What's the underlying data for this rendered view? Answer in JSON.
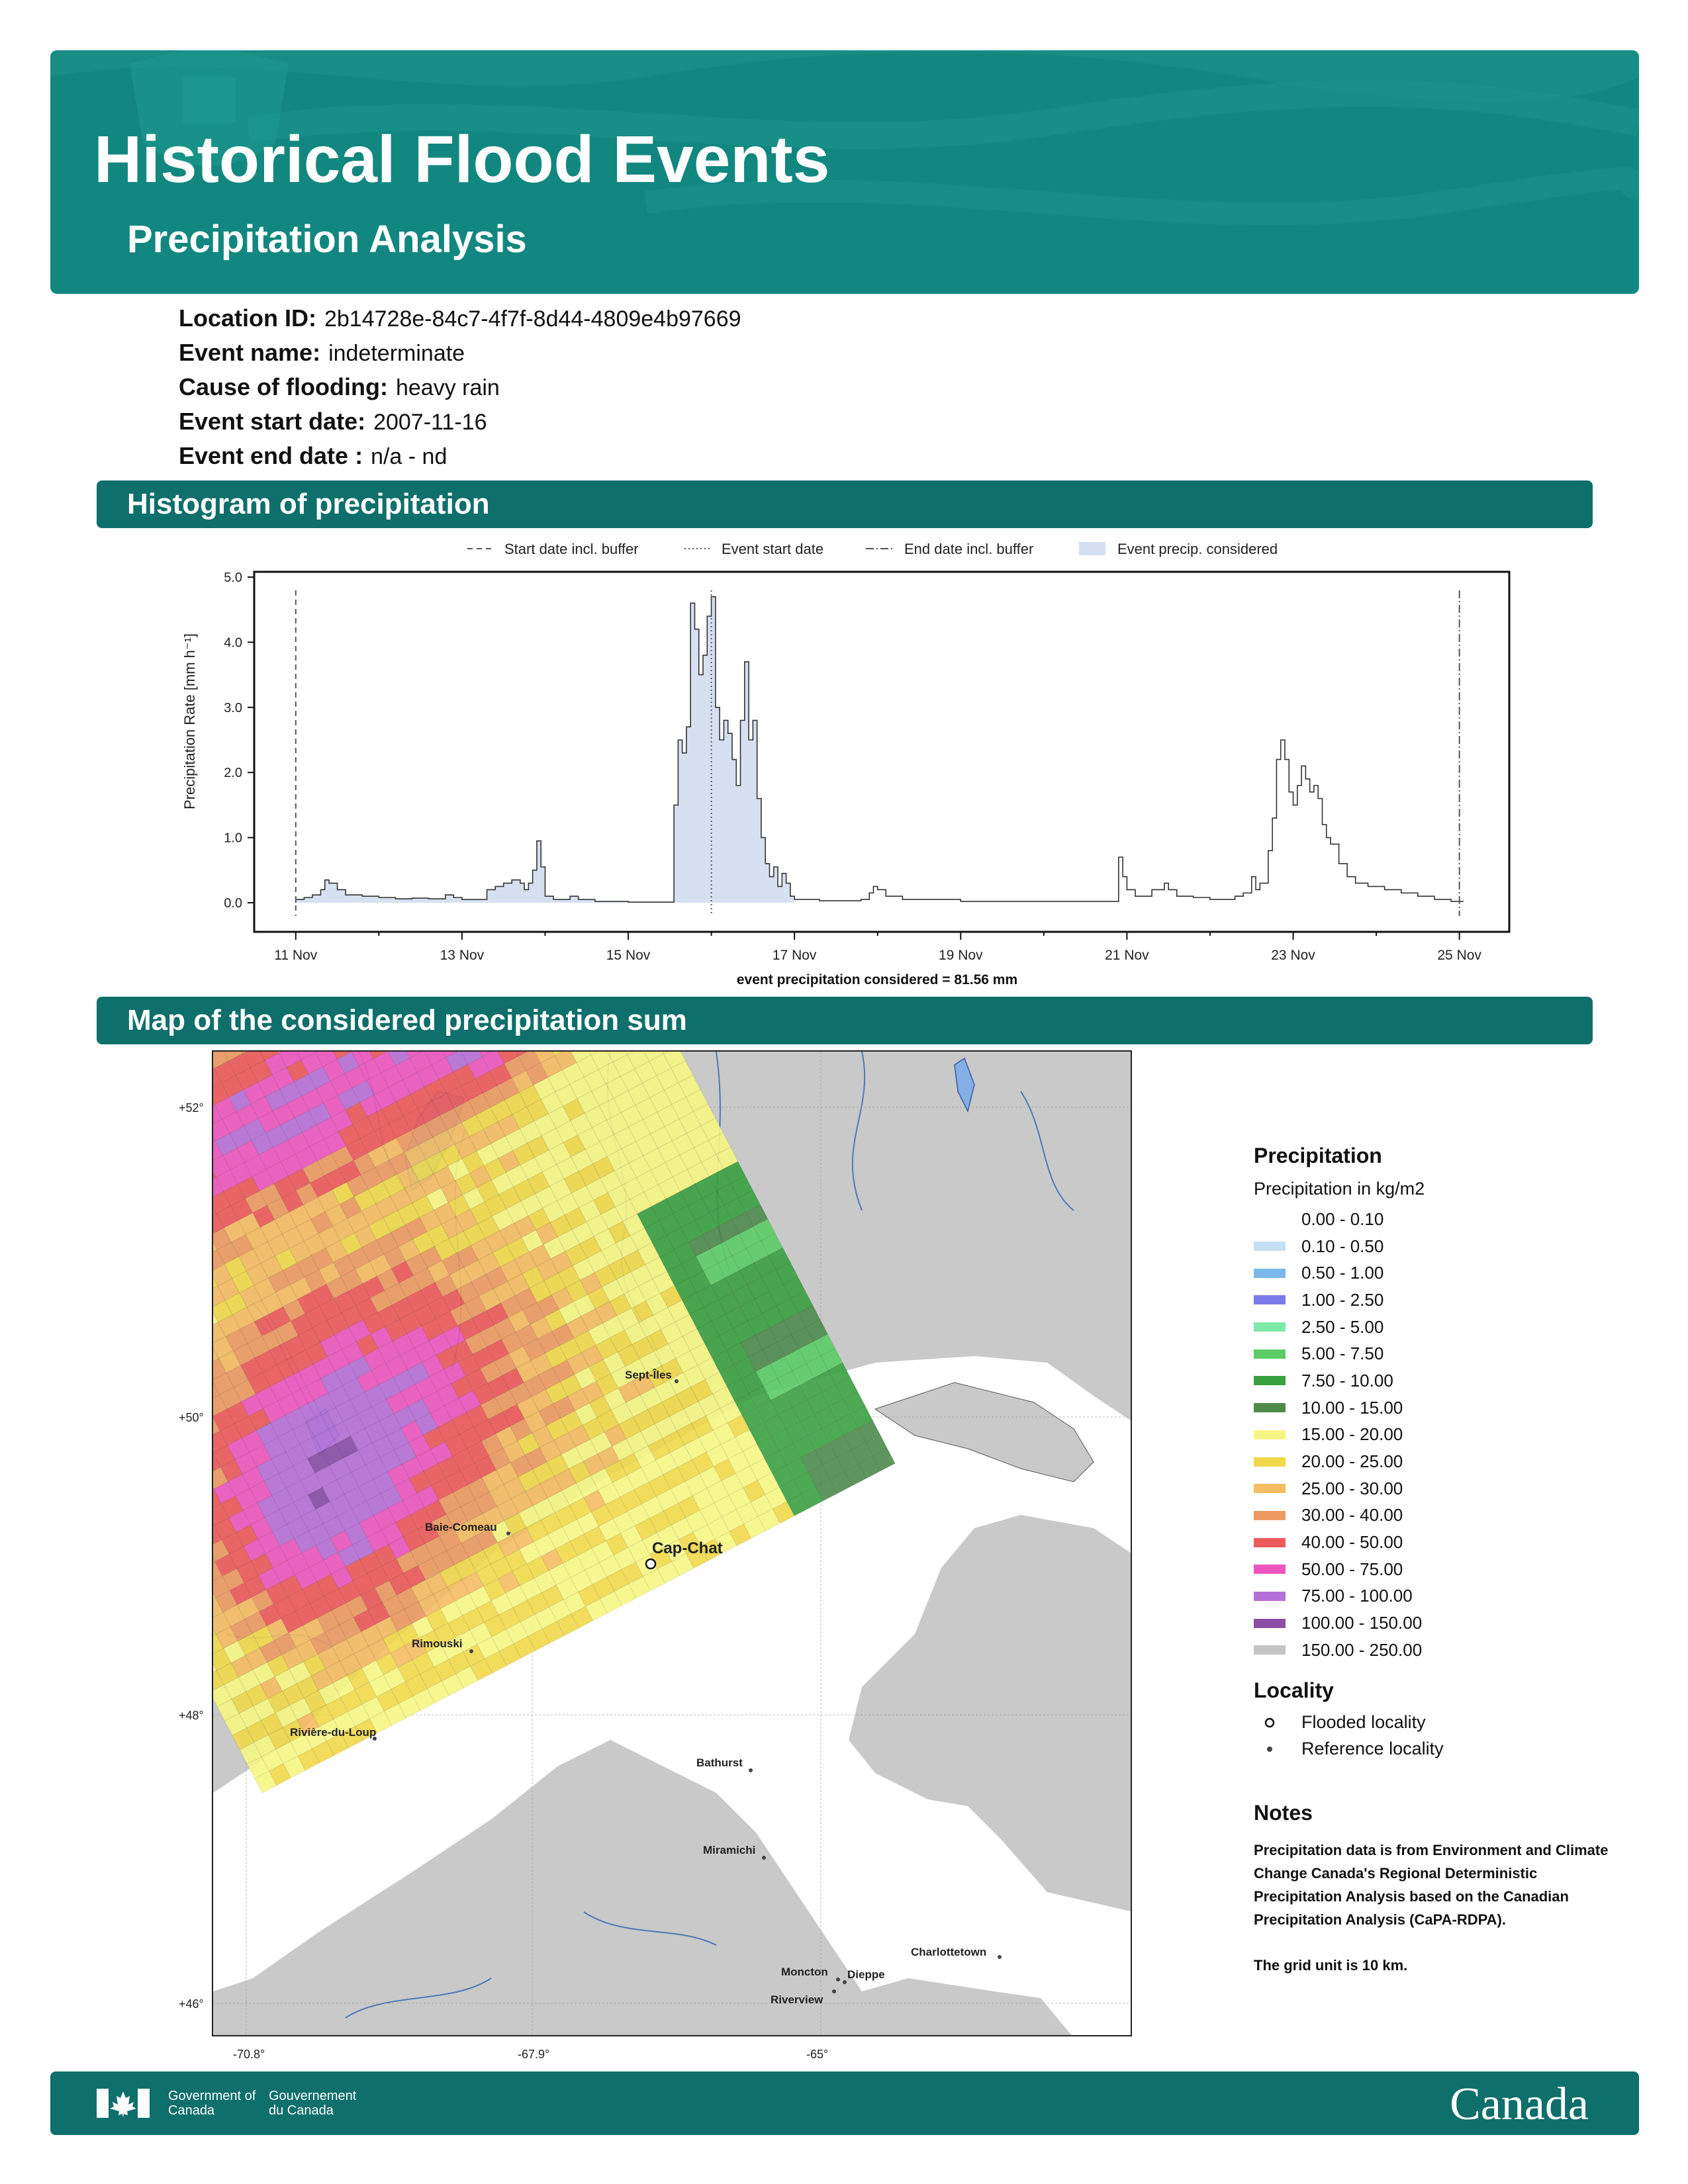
{
  "header": {
    "title": "Historical Flood Events",
    "subtitle": "Precipitation Analysis"
  },
  "info": [
    {
      "label": "Location ID:",
      "value": "2b14728e-84c7-4f7f-8d44-4809e4b97669"
    },
    {
      "label": "Event name:",
      "value": "indeterminate"
    },
    {
      "label": "Cause of flooding:",
      "value": "heavy rain"
    },
    {
      "label": "Event start date:",
      "value": "2007-11-16"
    },
    {
      "label": "Event end date :",
      "value": "n/a - nd"
    }
  ],
  "sections": {
    "histogram": "Histogram of precipitation",
    "map": "Map of the considered precipitation sum"
  },
  "chart_data": {
    "type": "area",
    "ylabel": "Precipitation Rate [mm h⁻¹]",
    "xlabel": "event precipitation considered = 81.56 mm",
    "ylim": [
      0,
      5.0
    ],
    "yticks": [
      "0.0",
      "1.0",
      "2.0",
      "3.0",
      "4.0",
      "5.0"
    ],
    "xticks": [
      "11 Nov",
      "13 Nov",
      "15 Nov",
      "17 Nov",
      "19 Nov",
      "21 Nov",
      "23 Nov",
      "25 Nov"
    ],
    "xlim_days": [
      10.5,
      25.6
    ],
    "legend": [
      "Start date incl. buffer",
      "Event start date",
      "End date incl. buffer",
      "Event precip. considered"
    ],
    "legend_position": "top",
    "start_buffer_day": 11.0,
    "event_start_day": 16.0,
    "end_buffer_day": 25.0,
    "considered_range_days": [
      11.0,
      17.0
    ],
    "series": [
      {
        "name": "Precipitation Rate",
        "points": [
          [
            11.0,
            0.05
          ],
          [
            11.1,
            0.08
          ],
          [
            11.2,
            0.12
          ],
          [
            11.3,
            0.2
          ],
          [
            11.35,
            0.35
          ],
          [
            11.4,
            0.3
          ],
          [
            11.5,
            0.2
          ],
          [
            11.6,
            0.12
          ],
          [
            11.8,
            0.1
          ],
          [
            12.0,
            0.08
          ],
          [
            12.2,
            0.06
          ],
          [
            12.4,
            0.07
          ],
          [
            12.6,
            0.06
          ],
          [
            12.8,
            0.12
          ],
          [
            12.9,
            0.08
          ],
          [
            13.0,
            0.05
          ],
          [
            13.2,
            0.05
          ],
          [
            13.3,
            0.2
          ],
          [
            13.4,
            0.25
          ],
          [
            13.5,
            0.3
          ],
          [
            13.6,
            0.35
          ],
          [
            13.7,
            0.3
          ],
          [
            13.75,
            0.2
          ],
          [
            13.8,
            0.3
          ],
          [
            13.85,
            0.5
          ],
          [
            13.9,
            0.95
          ],
          [
            13.95,
            0.55
          ],
          [
            14.0,
            0.1
          ],
          [
            14.1,
            0.05
          ],
          [
            14.3,
            0.1
          ],
          [
            14.4,
            0.05
          ],
          [
            14.6,
            0.02
          ],
          [
            15.0,
            0.01
          ],
          [
            15.5,
            0.01
          ],
          [
            15.55,
            1.5
          ],
          [
            15.6,
            2.5
          ],
          [
            15.65,
            2.3
          ],
          [
            15.7,
            2.7
          ],
          [
            15.75,
            4.6
          ],
          [
            15.8,
            4.2
          ],
          [
            15.85,
            3.5
          ],
          [
            15.9,
            3.8
          ],
          [
            15.95,
            4.4
          ],
          [
            16.0,
            4.7
          ],
          [
            16.05,
            3.0
          ],
          [
            16.1,
            2.5
          ],
          [
            16.15,
            2.8
          ],
          [
            16.2,
            2.6
          ],
          [
            16.25,
            2.2
          ],
          [
            16.3,
            1.8
          ],
          [
            16.35,
            2.8
          ],
          [
            16.4,
            3.7
          ],
          [
            16.45,
            2.5
          ],
          [
            16.5,
            2.8
          ],
          [
            16.55,
            1.6
          ],
          [
            16.6,
            1.0
          ],
          [
            16.65,
            0.6
          ],
          [
            16.7,
            0.4
          ],
          [
            16.75,
            0.55
          ],
          [
            16.8,
            0.25
          ],
          [
            16.85,
            0.45
          ],
          [
            16.9,
            0.3
          ],
          [
            16.95,
            0.1
          ],
          [
            17.0,
            0.05
          ],
          [
            17.3,
            0.03
          ],
          [
            17.8,
            0.05
          ],
          [
            17.9,
            0.15
          ],
          [
            17.95,
            0.25
          ],
          [
            18.0,
            0.2
          ],
          [
            18.1,
            0.1
          ],
          [
            18.3,
            0.05
          ],
          [
            18.6,
            0.05
          ],
          [
            19.0,
            0.02
          ],
          [
            19.5,
            0.02
          ],
          [
            20.0,
            0.02
          ],
          [
            20.5,
            0.02
          ],
          [
            20.85,
            0.02
          ],
          [
            20.9,
            0.7
          ],
          [
            20.95,
            0.4
          ],
          [
            21.0,
            0.2
          ],
          [
            21.1,
            0.1
          ],
          [
            21.3,
            0.2
          ],
          [
            21.45,
            0.3
          ],
          [
            21.5,
            0.2
          ],
          [
            21.6,
            0.1
          ],
          [
            21.8,
            0.08
          ],
          [
            22.0,
            0.05
          ],
          [
            22.2,
            0.05
          ],
          [
            22.3,
            0.1
          ],
          [
            22.4,
            0.15
          ],
          [
            22.5,
            0.4
          ],
          [
            22.55,
            0.2
          ],
          [
            22.6,
            0.3
          ],
          [
            22.7,
            0.8
          ],
          [
            22.75,
            1.3
          ],
          [
            22.8,
            2.2
          ],
          [
            22.85,
            2.5
          ],
          [
            22.9,
            2.2
          ],
          [
            22.95,
            1.7
          ],
          [
            23.0,
            1.5
          ],
          [
            23.05,
            1.8
          ],
          [
            23.1,
            2.1
          ],
          [
            23.15,
            1.9
          ],
          [
            23.2,
            1.7
          ],
          [
            23.25,
            1.8
          ],
          [
            23.3,
            1.6
          ],
          [
            23.35,
            1.2
          ],
          [
            23.4,
            1.0
          ],
          [
            23.45,
            0.9
          ],
          [
            23.55,
            0.6
          ],
          [
            23.65,
            0.4
          ],
          [
            23.75,
            0.3
          ],
          [
            23.9,
            0.25
          ],
          [
            24.1,
            0.2
          ],
          [
            24.3,
            0.15
          ],
          [
            24.5,
            0.1
          ],
          [
            24.7,
            0.05
          ],
          [
            24.9,
            0.02
          ],
          [
            25.0,
            0.02
          ]
        ]
      }
    ]
  },
  "map": {
    "lat_labels": [
      "+52°",
      "+50°",
      "+48°",
      "+46°"
    ],
    "lon_labels": [
      "-70.8°",
      "-67.9°",
      "-65°"
    ],
    "localities": [
      {
        "name": "Cap-Chat",
        "type": "flooded"
      },
      {
        "name": "Sept-Îles",
        "type": "reference"
      },
      {
        "name": "Baie-Comeau",
        "type": "reference"
      },
      {
        "name": "Rimouski",
        "type": "reference"
      },
      {
        "name": "Rivière-du-Loup",
        "type": "reference"
      },
      {
        "name": "Bathurst",
        "type": "reference"
      },
      {
        "name": "Miramichi",
        "type": "reference"
      },
      {
        "name": "Moncton",
        "type": "reference"
      },
      {
        "name": "Dieppe",
        "type": "reference"
      },
      {
        "name": "Riverview",
        "type": "reference"
      },
      {
        "name": "Charlottetown",
        "type": "reference"
      }
    ]
  },
  "legend": {
    "title": "Precipitation",
    "subtitle": "Precipitation in kg/m2",
    "classes": [
      {
        "label": "0.00 - 0.10",
        "color": "#ffffff"
      },
      {
        "label": "0.10 - 0.50",
        "color": "#c6def4"
      },
      {
        "label": "0.50 - 1.00",
        "color": "#7ab8ec"
      },
      {
        "label": "1.00 - 2.50",
        "color": "#7c7ce8"
      },
      {
        "label": "2.50 - 5.00",
        "color": "#7ee8a8"
      },
      {
        "label": "5.00 - 7.50",
        "color": "#5ccc66"
      },
      {
        "label": "7.50 - 10.00",
        "color": "#3aa040"
      },
      {
        "label": "10.00 - 15.00",
        "color": "#4e8a4c"
      },
      {
        "label": "15.00 - 20.00",
        "color": "#f6f684"
      },
      {
        "label": "20.00 - 25.00",
        "color": "#f0d84a"
      },
      {
        "label": "25.00 - 30.00",
        "color": "#f4bd62"
      },
      {
        "label": "30.00 - 40.00",
        "color": "#ec9a62"
      },
      {
        "label": "40.00 - 50.00",
        "color": "#ec5a5a"
      },
      {
        "label": "50.00 - 75.00",
        "color": "#ec56be"
      },
      {
        "label": "75.00 - 100.00",
        "color": "#b670d6"
      },
      {
        "label": "100.00 - 150.00",
        "color": "#8a4ea6"
      },
      {
        "label": "150.00 - 250.00",
        "color": "#c4c4c4"
      }
    ],
    "locality_title": "Locality",
    "flooded_label": "Flooded locality",
    "reference_label": "Reference locality",
    "notes_title": "Notes",
    "note1": "Precipitation data is from Environment and Climate Change Canada's Regional Deterministic Precipitation Analysis based on the Canadian Precipitation Analysis (CaPA-RDPA).",
    "note2": "The grid unit is 10 km."
  },
  "footer": {
    "gov_en": "Government of Canada",
    "gov_fr": "Gouvernement du Canada",
    "wordmark": "Canada"
  }
}
